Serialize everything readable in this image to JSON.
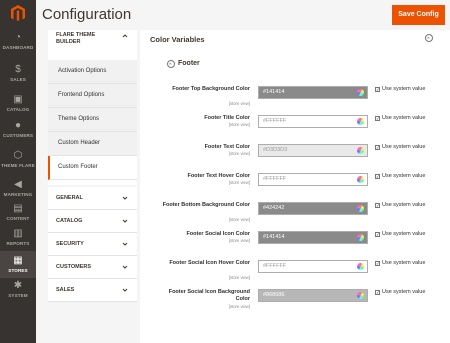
{
  "app": {
    "title": "Configuration",
    "save_label": "Save Config"
  },
  "nav": [
    {
      "label": "DASHBOARD",
      "icon": "dashboard-icon",
      "glyph": "◔"
    },
    {
      "label": "SALES",
      "icon": "dollar-icon",
      "glyph": "$"
    },
    {
      "label": "CATALOG",
      "icon": "box-icon",
      "glyph": "▣"
    },
    {
      "label": "CUSTOMERS",
      "icon": "person-icon",
      "glyph": "●"
    },
    {
      "label": "THEME FLARE",
      "icon": "hexagon-icon",
      "glyph": "⬡"
    },
    {
      "label": "MARKETING",
      "icon": "megaphone-icon",
      "glyph": "◀"
    },
    {
      "label": "CONTENT",
      "icon": "page-icon",
      "glyph": "▤"
    },
    {
      "label": "REPORTS",
      "icon": "bar-chart-icon",
      "glyph": "▥"
    },
    {
      "label": "STORES",
      "icon": "store-icon",
      "glyph": "▦"
    },
    {
      "label": "SYSTEM",
      "icon": "gear-icon",
      "glyph": "✱"
    }
  ],
  "tabs": {
    "flare": {
      "title": "FLARE THEME BUILDER",
      "items": [
        "Activation Options",
        "Frontend Options",
        "Theme Options",
        "Custom Header",
        "Custom Footer"
      ],
      "active": "Custom Footer"
    },
    "groups": [
      "GENERAL",
      "CATALOG",
      "SECURITY",
      "CUSTOMERS",
      "SALES"
    ]
  },
  "main": {
    "section_title": "Color Variables",
    "subsection_title": "Footer",
    "scope_label": "[store view]",
    "use_system_label": "Use system value",
    "rows": [
      {
        "label": "Footer Top Background Color",
        "value": "#141414",
        "bg": "#8a8a8a"
      },
      {
        "label": "Footer Title Color",
        "value": "#FFFFFF",
        "bg": "#ffffff"
      },
      {
        "label": "Footer Text Color",
        "value": "#D3D3D3",
        "bg": "#e9e9e9"
      },
      {
        "label": "Footer Text Hover Color",
        "value": "#FFFFFF",
        "bg": "#ffffff"
      },
      {
        "label": "Footer Bottom Background Color",
        "value": "#424242",
        "bg": "#8a8a8a"
      },
      {
        "label": "Footer Social Icon Color",
        "value": "#141414",
        "bg": "#8a8a8a"
      },
      {
        "label": "Footer Social Icon Hover Color",
        "value": "#FFFFFF",
        "bg": "#ffffff"
      },
      {
        "label": "Footer Social Icon Background Color",
        "value": "#868686",
        "bg": "#b7b7b7"
      }
    ]
  },
  "colors": {
    "accent": "#eb5202",
    "nav_bg": "#373330"
  }
}
